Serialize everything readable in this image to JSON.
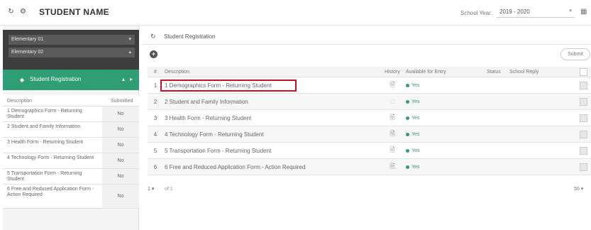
{
  "header": {
    "title": "STUDENT NAME",
    "school_year_label": "School Year:",
    "school_year_value": "2019 - 2020"
  },
  "sidebar": {
    "groups": [
      {
        "label": "Elementary 01"
      },
      {
        "label": "Elementary 02"
      }
    ],
    "active_item": "Student Registration",
    "table": {
      "headers": [
        "Description",
        "Submitted"
      ],
      "rows": [
        {
          "description": "1 Demographics Form - Returning Student",
          "submitted": "No"
        },
        {
          "description": "2 Student and Family Information",
          "submitted": "No"
        },
        {
          "description": "3 Health Form - Returning Student",
          "submitted": "No"
        },
        {
          "description": "4 Technology Form - Returning Student",
          "submitted": "No"
        },
        {
          "description": "5 Transportation Form - Returning Student",
          "submitted": "No"
        },
        {
          "description": "6 Free and Reduced Application Form - Action Required",
          "submitted": "No"
        }
      ]
    }
  },
  "main": {
    "breadcrumb": "Student Registration",
    "submit_label": "Submit",
    "columns": [
      "#",
      "Description",
      "History",
      "Available for Entry",
      "Status",
      "School Reply"
    ],
    "rows": [
      {
        "num": "1",
        "description": "1 Demographics Form - Returning Student",
        "available": "Yes",
        "status": "",
        "reply": ""
      },
      {
        "num": "2",
        "description": "2 Student and Family Information",
        "available": "Yes",
        "status": "",
        "reply": ""
      },
      {
        "num": "3",
        "description": "3 Health Form - Returning Student",
        "available": "Yes",
        "status": "",
        "reply": ""
      },
      {
        "num": "4",
        "description": "4 Technology Form - Returning Student",
        "available": "Yes",
        "status": "",
        "reply": ""
      },
      {
        "num": "5",
        "description": "5 Transportation Form - Returning Student",
        "available": "Yes",
        "status": "",
        "reply": ""
      },
      {
        "num": "6",
        "description": "6 Free and Reduced Application Form - Action Required",
        "available": "Yes",
        "status": "",
        "reply": ""
      }
    ],
    "pager": {
      "page": "1",
      "of_text": "of 1",
      "page_size": "50"
    }
  },
  "icons": {
    "refresh": "refresh-icon",
    "settings": "gear-icon",
    "calendar": "calendar-icon",
    "document": "document-icon",
    "add": "add-icon"
  },
  "colors": {
    "accent_green": "#2f9e76",
    "highlight_red": "#c8102e",
    "sidebar_dark": "#3d3d3d"
  }
}
